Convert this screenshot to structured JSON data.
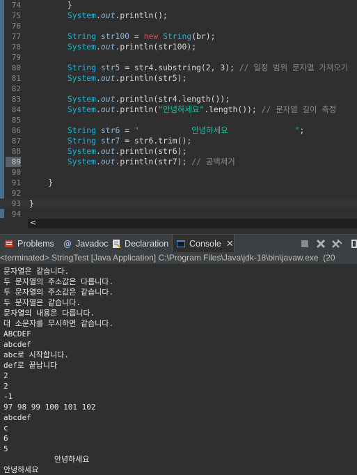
{
  "editor": {
    "lines": [
      {
        "n": "74",
        "tokens": [
          {
            "t": "        }",
            "c": "plain"
          }
        ]
      },
      {
        "n": "75",
        "tokens": [
          {
            "t": "        ",
            "c": "plain"
          },
          {
            "t": "System",
            "c": "cls"
          },
          {
            "t": ".",
            "c": "plain"
          },
          {
            "t": "out",
            "c": "fld"
          },
          {
            "t": ".println();",
            "c": "plain"
          }
        ]
      },
      {
        "n": "76",
        "tokens": []
      },
      {
        "n": "77",
        "tokens": [
          {
            "t": "        ",
            "c": "plain"
          },
          {
            "t": "String ",
            "c": "cls"
          },
          {
            "t": "str100",
            "c": "var"
          },
          {
            "t": " = ",
            "c": "plain"
          },
          {
            "t": "new ",
            "c": "kw"
          },
          {
            "t": "String",
            "c": "cls"
          },
          {
            "t": "(br);",
            "c": "plain"
          }
        ]
      },
      {
        "n": "78",
        "tokens": [
          {
            "t": "        ",
            "c": "plain"
          },
          {
            "t": "System",
            "c": "cls"
          },
          {
            "t": ".",
            "c": "plain"
          },
          {
            "t": "out",
            "c": "fld"
          },
          {
            "t": ".println(str100);",
            "c": "plain"
          }
        ]
      },
      {
        "n": "79",
        "tokens": []
      },
      {
        "n": "80",
        "tokens": [
          {
            "t": "        ",
            "c": "plain"
          },
          {
            "t": "String ",
            "c": "cls"
          },
          {
            "t": "str5",
            "c": "var"
          },
          {
            "t": " = str4.substring(",
            "c": "plain"
          },
          {
            "t": "2",
            "c": "num"
          },
          {
            "t": ", ",
            "c": "plain"
          },
          {
            "t": "3",
            "c": "num"
          },
          {
            "t": "); ",
            "c": "plain"
          },
          {
            "t": "// 일정 범위 문자열 가져오기",
            "c": "cmt"
          }
        ]
      },
      {
        "n": "81",
        "tokens": [
          {
            "t": "        ",
            "c": "plain"
          },
          {
            "t": "System",
            "c": "cls"
          },
          {
            "t": ".",
            "c": "plain"
          },
          {
            "t": "out",
            "c": "fld"
          },
          {
            "t": ".println(str5);",
            "c": "plain"
          }
        ]
      },
      {
        "n": "82",
        "tokens": []
      },
      {
        "n": "83",
        "tokens": [
          {
            "t": "        ",
            "c": "plain"
          },
          {
            "t": "System",
            "c": "cls"
          },
          {
            "t": ".",
            "c": "plain"
          },
          {
            "t": "out",
            "c": "fld"
          },
          {
            "t": ".println(str4.length());",
            "c": "plain"
          }
        ]
      },
      {
        "n": "84",
        "tokens": [
          {
            "t": "        ",
            "c": "plain"
          },
          {
            "t": "System",
            "c": "cls"
          },
          {
            "t": ".",
            "c": "plain"
          },
          {
            "t": "out",
            "c": "fld"
          },
          {
            "t": ".println(",
            "c": "plain"
          },
          {
            "t": "\"안녕하세요\"",
            "c": "str"
          },
          {
            "t": ".length()); ",
            "c": "plain"
          },
          {
            "t": "// 문자열 길이 측정",
            "c": "cmt"
          }
        ]
      },
      {
        "n": "85",
        "tokens": []
      },
      {
        "n": "86",
        "tokens": [
          {
            "t": "        ",
            "c": "plain"
          },
          {
            "t": "String ",
            "c": "cls"
          },
          {
            "t": "str6",
            "c": "var"
          },
          {
            "t": " = ",
            "c": "plain"
          },
          {
            "t": "\"           안녕하세요              \"",
            "c": "str"
          },
          {
            "t": ";",
            "c": "plain"
          }
        ]
      },
      {
        "n": "87",
        "tokens": [
          {
            "t": "        ",
            "c": "plain"
          },
          {
            "t": "String ",
            "c": "cls"
          },
          {
            "t": "str7",
            "c": "var"
          },
          {
            "t": " = str6.trim();",
            "c": "plain"
          }
        ]
      },
      {
        "n": "88",
        "tokens": [
          {
            "t": "        ",
            "c": "plain"
          },
          {
            "t": "System",
            "c": "cls"
          },
          {
            "t": ".",
            "c": "plain"
          },
          {
            "t": "out",
            "c": "fld"
          },
          {
            "t": ".println(str6);",
            "c": "plain"
          }
        ]
      },
      {
        "n": "89",
        "tokens": [
          {
            "t": "        ",
            "c": "plain"
          },
          {
            "t": "System",
            "c": "cls"
          },
          {
            "t": ".",
            "c": "plain"
          },
          {
            "t": "out",
            "c": "fld"
          },
          {
            "t": ".println(str7); ",
            "c": "plain"
          },
          {
            "t": "// 공백제거",
            "c": "cmt"
          }
        ]
      },
      {
        "n": "90",
        "tokens": []
      },
      {
        "n": "91",
        "tokens": [
          {
            "t": "    }",
            "c": "plain"
          }
        ]
      },
      {
        "n": "92",
        "tokens": []
      },
      {
        "n": "93",
        "tokens": [
          {
            "t": "}",
            "c": "plain"
          }
        ]
      },
      {
        "n": "94",
        "tokens": []
      }
    ],
    "highlighted_line": "93",
    "hl_number_line": "89"
  },
  "scrollbar": {
    "left_arrow": "<"
  },
  "tabs": [
    {
      "label": "Problems",
      "icon": "problems-icon",
      "active": false
    },
    {
      "label": "Javadoc",
      "icon": "javadoc-icon",
      "active": false
    },
    {
      "label": "Declaration",
      "icon": "declaration-icon",
      "active": false
    },
    {
      "label": "Console",
      "icon": "console-icon",
      "active": true
    }
  ],
  "toolbar_icons": [
    "terminate-icon",
    "remove-launch-icon",
    "remove-all-launches-icon",
    "display-console-icon"
  ],
  "status": "<terminated> StringTest [Java Application] C:\\Program Files\\Java\\jdk-18\\bin\\javaw.exe  (20",
  "console": [
    "문자열은 같습니다.",
    "두 문자열의 주소값은 다릅니다.",
    "두 문자열의 주소값은 같습니다.",
    "두 문자열은 같습니다.",
    "문자열의 내용은 다릅니다.",
    "대 소문자를 무시하면 같습니다.",
    "ABCDEF",
    "abcdef",
    "abc로 시작합니다.",
    "def로 끝납니다",
    "2",
    "2",
    "-1",
    "97 98 99 100 101 102",
    "abcdef",
    "c",
    "6",
    "5",
    "           안녕하세요",
    "안녕하세요"
  ],
  "colors": {
    "editor_bg": "#2f2f2f",
    "keyword": "#d25252",
    "type": "#1eb4d6",
    "string": "#17c6a3",
    "comment": "#8a8a8a"
  }
}
